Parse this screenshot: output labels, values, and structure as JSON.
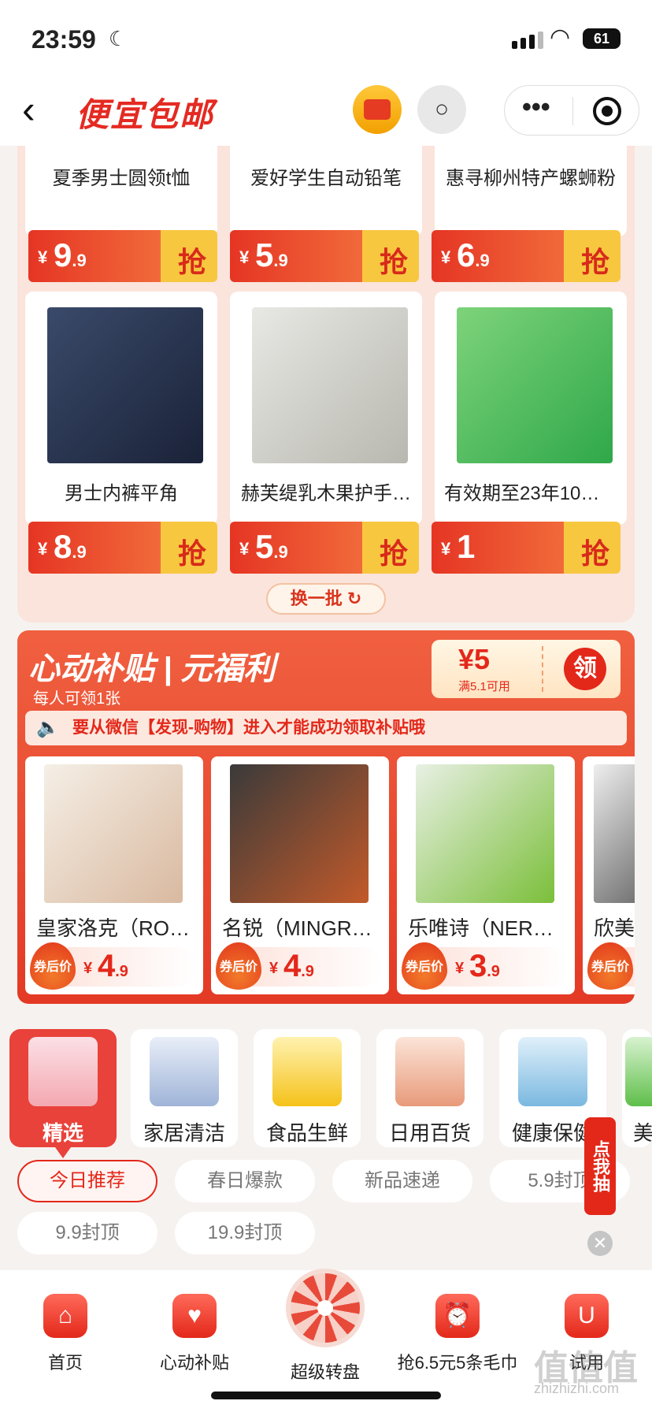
{
  "status": {
    "time": "23:59",
    "battery": "61"
  },
  "header": {
    "brand": "便宜包邮"
  },
  "grid": {
    "row1": [
      {
        "name": "夏季男士圆领t恤",
        "price_int": "9",
        "price_dec": ".9"
      },
      {
        "name": "爱好学生自动铅笔",
        "price_int": "5",
        "price_dec": ".9"
      },
      {
        "name": "惠寻柳州特产螺蛳粉",
        "price_int": "6",
        "price_dec": ".9"
      }
    ],
    "row2": [
      {
        "name": "男士内裤平角",
        "price_int": "8",
        "price_dec": ".9"
      },
      {
        "name": "赫芙缇乳木果护手…",
        "price_int": "5",
        "price_dec": ".9"
      },
      {
        "name": "有效期至23年10月…",
        "price_int": "1",
        "price_dec": ""
      }
    ],
    "yen": "¥",
    "grab": "抢",
    "refresh": "换一批"
  },
  "subsidy": {
    "title": "心动补贴 | 元福利",
    "note": "每人可领1张",
    "coupon_amount": "¥5",
    "coupon_condition": "满5.1可用",
    "coupon_get": "领",
    "notice": "要从微信【发现-购物】进入才能成功领取补贴哦",
    "after_coupon": "券后价",
    "items": [
      {
        "name": "皇家洛克（RO…",
        "price_int": "4",
        "price_dec": ".9"
      },
      {
        "name": "名锐（MINGR…",
        "price_int": "4",
        "price_dec": ".9"
      },
      {
        "name": "乐唯诗（NER…",
        "price_int": "3",
        "price_dec": ".9"
      },
      {
        "name": "欣美",
        "price_int": "",
        "price_dec": ""
      }
    ]
  },
  "categories": [
    "精选",
    "家居清洁",
    "食品生鲜",
    "日用百货",
    "健康保健",
    "美"
  ],
  "tags": [
    "今日推荐",
    "春日爆款",
    "新品速递",
    "5.9封顶",
    "9.9封顶",
    "19.9封顶"
  ],
  "float_label": "点我抽",
  "nav": [
    "首页",
    "心动补贴",
    "超级转盘",
    "抢6.5元5条毛巾",
    "试用"
  ],
  "watermark": {
    "main": "值值值",
    "url": "zhizhizhi.com"
  },
  "colors": {
    "accent": "#e3281a",
    "panel": "#fbe4dc"
  }
}
